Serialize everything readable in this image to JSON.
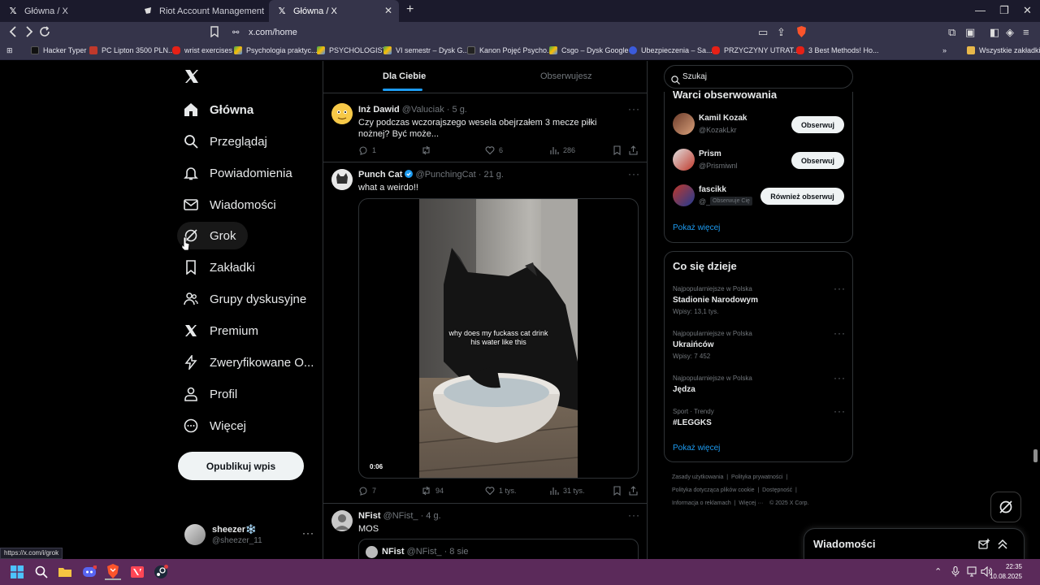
{
  "browser": {
    "tabs": [
      {
        "title": "Główna / X",
        "active": false
      },
      {
        "title": "Riot Account Management",
        "active": false
      },
      {
        "title": "Główna / X",
        "active": true
      }
    ],
    "url": "x.com/home",
    "bookmarks": [
      "Hacker Typer",
      "PC Lipton 3500 PLN...",
      "wrist exercises",
      "Psychologia praktyc...",
      "PSYCHOLOGIST",
      "VI semestr – Dysk G...",
      "Kanon Pojęć Psycho...",
      "Csgo – Dysk Google",
      "Ubezpieczenia – Sa...",
      "PRZYCZYNY UTRAT...",
      "3 Best Methods! Ho..."
    ],
    "bookmarks_folder": "Wszystkie zakładki",
    "status_url": "https://x.com/i/grok"
  },
  "nav": {
    "items": [
      "Główna",
      "Przeglądaj",
      "Powiadomienia",
      "Wiadomości",
      "Grok",
      "Zakładki",
      "Grupy dyskusyjne",
      "Premium",
      "Zweryfikowane O...",
      "Profil",
      "Więcej"
    ],
    "publish": "Opublikuj wpis"
  },
  "account": {
    "name": "sheezer❄️",
    "handle": "@sheezer_11"
  },
  "feed": {
    "tabs": [
      "Dla Ciebie",
      "Obserwujesz"
    ],
    "posts": [
      {
        "name": "Inż Dawid",
        "handle": "@Valuciak",
        "time": "· 5 g.",
        "text": "Czy podczas wczorajszego wesela obejrzałem 3 mecze piłki nożnej? Być może...",
        "replies": "1",
        "reposts": "",
        "likes": "6",
        "views": "286"
      },
      {
        "name": "Punch Cat",
        "handle": "@PunchingCat",
        "time": "· 21 g.",
        "text": "what a weirdo!!",
        "video_caption": "why does my fuckass cat drink his water like this",
        "video_time": "0:06",
        "replies": "7",
        "reposts": "94",
        "likes": "1 tys.",
        "views": "31 tys."
      },
      {
        "name": "NFist",
        "handle": "@NFist_",
        "time": "· 4 g.",
        "text": "MOS",
        "quote_name": "NFist",
        "quote_handle": "@NFist_",
        "quote_time": "· 8 sie"
      }
    ]
  },
  "right": {
    "search_placeholder": "Szukaj",
    "who_to_follow": {
      "title": "Warci obserwowania",
      "users": [
        {
          "name": "Kamil Kozak",
          "handle": "@KozakLkr",
          "button": "Obserwuj"
        },
        {
          "name": "Prism",
          "handle": "@Prismiwnl",
          "button": "Obserwuj"
        },
        {
          "name": "fascikk",
          "handle": "@_",
          "badge": "Obserwuje Cię",
          "button": "Również obserwuj"
        }
      ],
      "more": "Pokaż więcej"
    },
    "trends": {
      "title": "Co się dzieje",
      "items": [
        {
          "category": "Najpopularniejsze w Polska",
          "title": "Stadionie Narodowym",
          "count": "Wpisy: 13,1 tys."
        },
        {
          "category": "Najpopularniejsze w Polska",
          "title": "Ukraińców",
          "count": "Wpisy: 7 452"
        },
        {
          "category": "Najpopularniejsze w Polska",
          "title": "Jędza",
          "count": ""
        },
        {
          "category": "Sport · Trendy",
          "title": "#LEGGKS",
          "count": ""
        }
      ],
      "more": "Pokaż więcej"
    },
    "footer": {
      "row1": [
        "Zasady użytkowania",
        "Polityka prywatności"
      ],
      "row2": [
        "Polityka dotycząca plików cookie",
        "Dostępność"
      ],
      "row3": [
        "Informacja o reklamach",
        "Więcej ···",
        "© 2025 X Corp."
      ]
    },
    "messages_drawer": "Wiadomości"
  },
  "taskbar": {
    "time": "22:35",
    "date": "10.08.2025"
  }
}
